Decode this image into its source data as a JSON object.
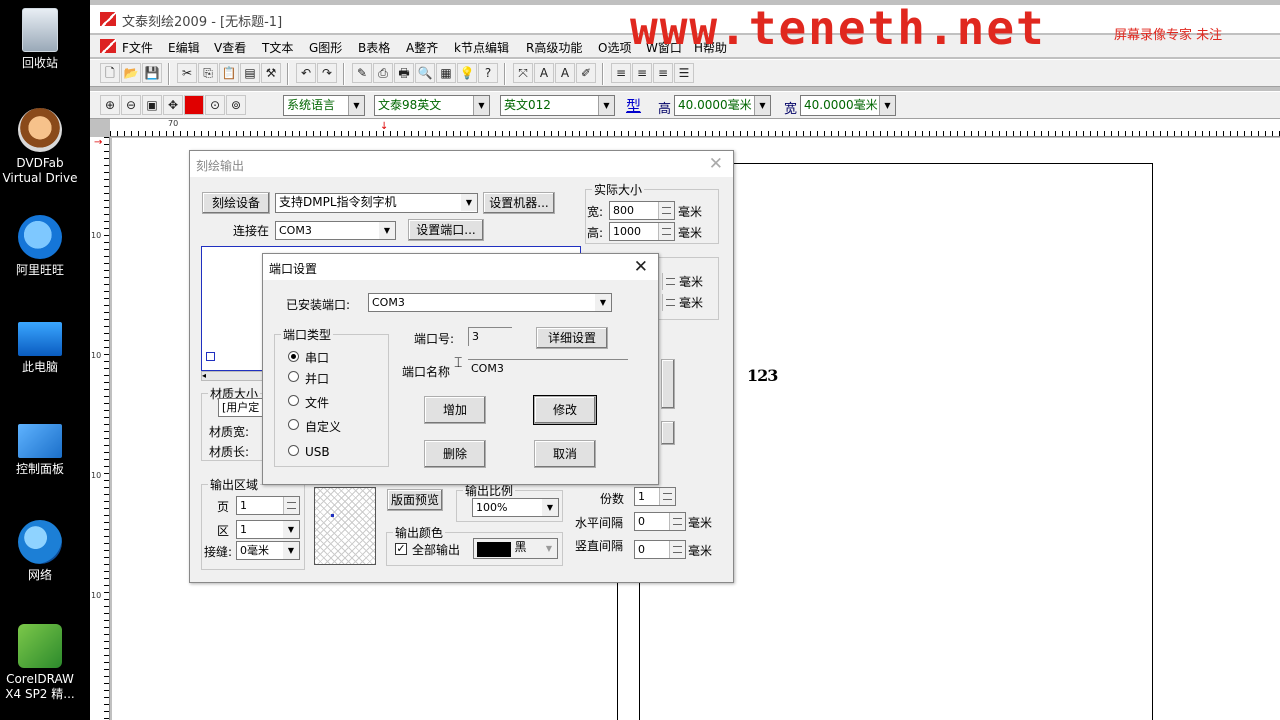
{
  "desktop": {
    "icons": [
      {
        "label": "回收站",
        "icon": "recycle-bin-icon"
      },
      {
        "label": "DVDFab\nVirtual Drive",
        "icon": "dvdfab-icon"
      },
      {
        "label": "阿里旺旺",
        "icon": "aliwangwang-icon"
      },
      {
        "label": "此电脑",
        "icon": "computer-icon"
      },
      {
        "label": "控制面板",
        "icon": "control-panel-icon"
      },
      {
        "label": "网络",
        "icon": "network-icon"
      },
      {
        "label": "CoreIDRAW\nX4 SP2 精...",
        "icon": "coreldraw-icon"
      }
    ]
  },
  "app": {
    "title": "文泰刻绘2009 - [无标题-1]",
    "watermark": "www.teneth.net",
    "watermark_note": "屏幕录像专家 未注",
    "menu": [
      "F文件",
      "E编辑",
      "V查看",
      "T文本",
      "G图形",
      "B表格",
      "A整齐",
      "k节点编辑",
      "R高级功能",
      "O选项",
      "W窗口",
      "H帮助"
    ],
    "toolbar2": {
      "language": "系统语言",
      "font_cn": "文泰98英文",
      "font_en": "英文012",
      "type_label": "型",
      "height_label": "高",
      "height_value": "40.0000毫米",
      "width_label": "宽",
      "width_value": "40.0000毫米"
    },
    "ruler_numbers": [
      "70",
      "10",
      "10",
      "10",
      "10"
    ],
    "canvas_text": "123"
  },
  "output_dialog": {
    "title": "刻绘输出",
    "device_button": "刻绘设备",
    "device_value": "支持DMPL指令刻字机",
    "setup_machine_button": "设置机器...",
    "connect_label": "连接在",
    "connect_value": "COM3",
    "setup_port_button": "设置端口...",
    "actual_size_title": "实际大小",
    "width_label": "宽:",
    "width_value": "800",
    "height_label": "高:",
    "height_value": "1000",
    "unit": "毫米",
    "material_size_title": "材质大小",
    "material_value": "[用户定",
    "material_width_label": "材质宽:",
    "material_length_label": "材质长:",
    "output_area_title": "输出区域",
    "page_label": "页",
    "page_value": "1",
    "area_label": "区",
    "area_value": "1",
    "seam_label": "接缝:",
    "seam_value": "0毫米",
    "preview_button": "版面预览",
    "ratio_title": "输出比例",
    "ratio_value": "100%",
    "copies_label": "份数",
    "copies_value": "1",
    "h_spacing_label": "水平间隔",
    "h_spacing_value": "0",
    "v_spacing_label": "竖直间隔",
    "v_spacing_value": "0",
    "color_title": "输出颜色",
    "all_output_label": "全部输出",
    "all_output_checked": true,
    "color_name": "黑",
    "color_hex": "#000000"
  },
  "port_dialog": {
    "title": "端口设置",
    "installed_label": "已安装端口:",
    "installed_value": "COM3",
    "port_type_title": "端口类型",
    "port_types": [
      {
        "label": "串口",
        "selected": true
      },
      {
        "label": "并口",
        "selected": false
      },
      {
        "label": "文件",
        "selected": false
      },
      {
        "label": "自定义",
        "selected": false
      },
      {
        "label": "USB",
        "selected": false
      }
    ],
    "port_no_label": "端口号:",
    "port_no_value": "3",
    "detail_button": "详细设置",
    "port_name_label": "端口名称",
    "port_name_value": "COM3",
    "add_button": "增加",
    "modify_button": "修改",
    "delete_button": "删除",
    "cancel_button": "取消"
  }
}
